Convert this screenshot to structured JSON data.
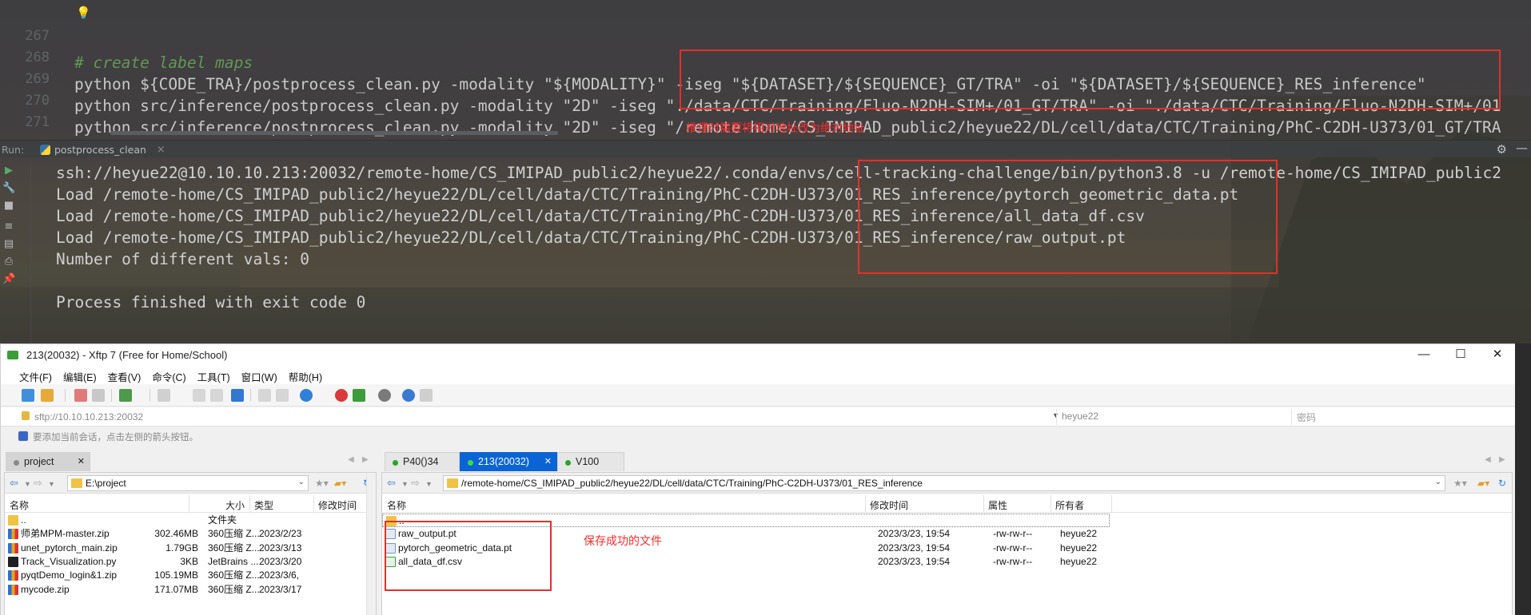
{
  "editor": {
    "lines": [
      {
        "no": "267",
        "text": "# create label maps",
        "kind": "comment"
      },
      {
        "no": "268",
        "text": "python ${CODE_TRA}/postprocess_clean.py -modality \"${MODALITY}\" -iseg \"${DATASET}/${SEQUENCE}_GT/TRA\" -oi \"${DATASET}/${SEQUENCE}_RES_inference\"",
        "kind": "code"
      },
      {
        "no": "269",
        "text": "python src/inference/postprocess_clean.py -modality \"2D\" -iseg \"./data/CTC/Training/Fluo-N2DH-SIM+/01_GT/TRA\" -oi \"./data/CTC/Training/Fluo-N2DH-SIM+/01",
        "kind": "code"
      },
      {
        "no": "270",
        "text": "python src/inference/postprocess_clean.py -modality \"2D\" -iseg \"/remote-home/CS_IMIPAD_public2/heyue22/DL/cell/data/CTC/Training/PhC-C2DH-U373/01_GT/TRA",
        "kind": "code"
      },
      {
        "no": "271",
        "text": "",
        "kind": "code"
      }
    ],
    "annotation": "推理时需要将相对地址改为绝对地址"
  },
  "run": {
    "label": "Run:",
    "tab_name": "postprocess_clean",
    "console": [
      "ssh://heyue22@10.10.10.213:20032/remote-home/CS_IMIPAD_public2/heyue22/.conda/envs/cell-tracking-challenge/bin/python3.8 -u /remote-home/CS_IMIPAD_public2",
      "Load /remote-home/CS_IMIPAD_public2/heyue22/DL/cell/data/CTC/Training/PhC-C2DH-U373/01_RES_inference/pytorch_geometric_data.pt",
      "Load /remote-home/CS_IMIPAD_public2/heyue22/DL/cell/data/CTC/Training/PhC-C2DH-U373/01_RES_inference/all_data_df.csv",
      "Load /remote-home/CS_IMIPAD_public2/heyue22/DL/cell/data/CTC/Training/PhC-C2DH-U373/01_RES_inference/raw_output.pt",
      "Number of different vals: 0",
      "",
      "Process finished with exit code 0"
    ]
  },
  "xftp": {
    "title": "213(20032) - Xftp 7 (Free for Home/School)",
    "menu": [
      "文件(F)",
      "编辑(E)",
      "查看(V)",
      "命令(C)",
      "工具(T)",
      "窗口(W)",
      "帮助(H)"
    ],
    "address": "sftp://10.10.10.213:20032",
    "username": "heyue22",
    "password_placeholder": "密码",
    "hint": "要添加当前会话，点击左侧的箭头按钮。",
    "left_tab": "project",
    "right_tabs": [
      "P40()34",
      "213(20032)",
      "V100"
    ],
    "left_path": "E:\\project",
    "right_path": "/remote-home/CS_IMIPAD_public2/heyue22/DL/cell/data/CTC/Training/PhC-C2DH-U373/01_RES_inference",
    "left_headers": [
      "名称",
      "大小",
      "类型",
      "修改时间"
    ],
    "right_headers": [
      "名称",
      "修改时间",
      "属性",
      "所有者"
    ],
    "left_files": [
      {
        "name": "..",
        "size": "",
        "type": "文件夹",
        "date": "",
        "icon": "folder-icon"
      },
      {
        "name": "师弟MPM-master.zip",
        "size": "302.46MB",
        "type": "360压缩 Z...",
        "date": "2023/2/23",
        "icon": "zip-icon"
      },
      {
        "name": "unet_pytorch_main.zip",
        "size": "1.79GB",
        "type": "360压缩 Z...",
        "date": "2023/3/13",
        "icon": "zip-icon"
      },
      {
        "name": "Track_Visualization.py",
        "size": "3KB",
        "type": "JetBrains ...",
        "date": "2023/3/20",
        "icon": "python-file-icon"
      },
      {
        "name": "pyqtDemo_login&1.zip",
        "size": "105.19MB",
        "type": "360压缩 Z...",
        "date": "2023/3/6,",
        "icon": "zip-icon"
      },
      {
        "name": "mycode.zip",
        "size": "171.07MB",
        "type": "360压缩 Z...",
        "date": "2023/3/17",
        "icon": "zip-icon"
      }
    ],
    "right_files": [
      {
        "name": "..",
        "date": "",
        "attr": "",
        "owner": "",
        "icon": "folder-icon"
      },
      {
        "name": "raw_output.pt",
        "date": "2023/3/23, 19:54",
        "attr": "-rw-rw-r--",
        "owner": "heyue22",
        "icon": "pt-file-icon"
      },
      {
        "name": "pytorch_geometric_data.pt",
        "date": "2023/3/23, 19:54",
        "attr": "-rw-rw-r--",
        "owner": "heyue22",
        "icon": "pt-file-icon"
      },
      {
        "name": "all_data_df.csv",
        "date": "2023/3/23, 19:54",
        "attr": "-rw-rw-r--",
        "owner": "heyue22",
        "icon": "csv-file-icon"
      }
    ],
    "annotation": "保存成功的文件"
  },
  "colors": {
    "annotation_red": "#e0312c",
    "active_tab_blue": "#0b64d6",
    "comment_green": "#629755"
  }
}
